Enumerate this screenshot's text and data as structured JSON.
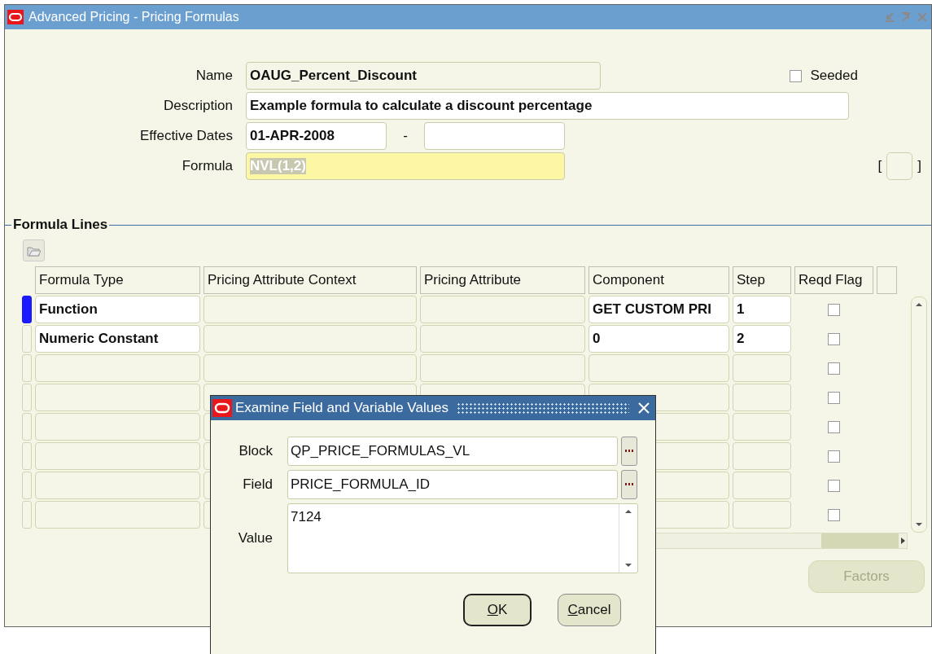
{
  "window": {
    "title": "Advanced Pricing - Pricing Formulas"
  },
  "header": {
    "name_label": "Name",
    "name": "OAUG_Percent_Discount",
    "seeded_label": "Seeded",
    "seeded": false,
    "description_label": "Description",
    "description": "Example formula to calculate a discount percentage",
    "dates_label": "Effective Dates",
    "date_from": "01-APR-2008",
    "date_separator": "-",
    "formula_label": "Formula",
    "formula": "NVL(1,2)",
    "formula_focused": true,
    "flex_open": "[",
    "flex_close": "]"
  },
  "formula_lines": {
    "title": "Formula Lines",
    "columns": [
      "Formula Type",
      "Pricing Attribute Context",
      "Pricing Attribute",
      "Component",
      "Step",
      "Reqd Flag"
    ],
    "rows": [
      {
        "formula_type": "Function",
        "component": "GET CUSTOM PRI",
        "step": "1",
        "reqd_flag": false,
        "selected": true
      },
      {
        "formula_type": "Numeric Constant",
        "component": "0",
        "step": "2",
        "reqd_flag": false,
        "selected": false
      },
      {
        "reqd_flag": false,
        "selected": false
      },
      {
        "reqd_flag": false,
        "selected": false
      },
      {
        "reqd_flag": false,
        "selected": false
      },
      {
        "reqd_flag": false,
        "selected": false
      },
      {
        "reqd_flag": false,
        "selected": false
      },
      {
        "reqd_flag": false,
        "selected": false
      }
    ],
    "factors_button": {
      "label": "Factors",
      "disabled": true
    }
  },
  "dialog": {
    "title": "Examine Field and Variable Values",
    "block_label": "Block",
    "block": "QP_PRICE_FORMULAS_VL",
    "field_label": "Field",
    "field": "PRICE_FORMULA_ID",
    "value_label": "Value",
    "value": "7124",
    "buttons": [
      {
        "label": "OK",
        "default": true
      },
      {
        "label": "Cancel",
        "default": false
      }
    ]
  }
}
